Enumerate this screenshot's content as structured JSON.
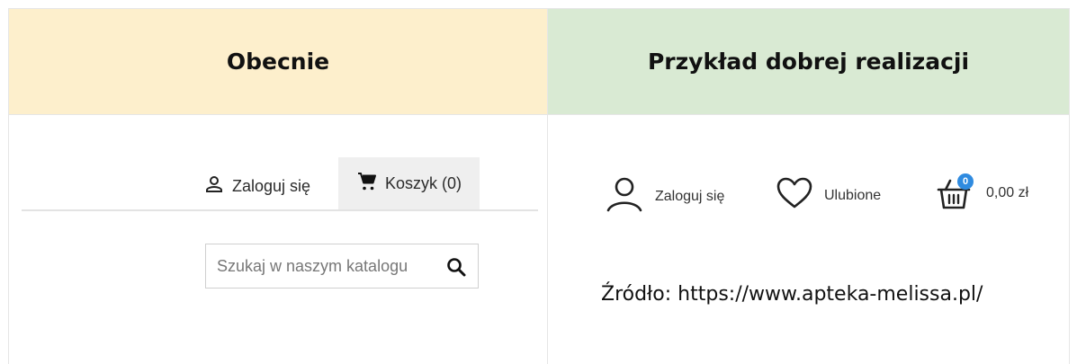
{
  "headers": {
    "left": "Obecnie",
    "right": "Przykład dobrej realizacji"
  },
  "current": {
    "login_label": "Zaloguj się",
    "cart_label": "Koszyk (0)",
    "search_placeholder": "Szukaj w naszym katalogu",
    "icons": [
      "user-icon",
      "cart-icon",
      "search-icon"
    ]
  },
  "good_example": {
    "login_label": "Zaloguj się",
    "favorites_label": "Ulubione",
    "cart_badge": "0",
    "cart_total": "0,00 zł",
    "source": "Źródło: https://www.apteka-melissa.pl/",
    "icons": [
      "user-icon",
      "heart-icon",
      "basket-icon"
    ],
    "badge_color": "#2f8be0"
  },
  "colors": {
    "left_header_bg": "#fdefcc",
    "right_header_bg": "#d9ead3"
  }
}
